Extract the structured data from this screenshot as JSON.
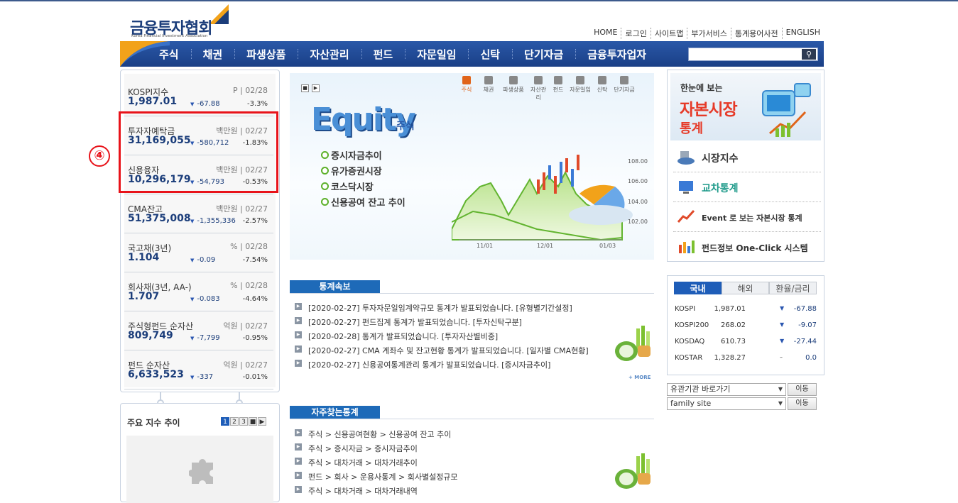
{
  "logo": {
    "name": "금융투자협회",
    "sub": "Korea Financial Investment Association"
  },
  "util_nav": [
    "HOME",
    "로그인",
    "사이트맵",
    "부가서비스",
    "통계용어사전",
    "ENGLISH"
  ],
  "gnb": [
    "주식",
    "채권",
    "파생상품",
    "자산관리",
    "펀드",
    "자문일임",
    "신탁",
    "단기자금",
    "금융투자업자"
  ],
  "indices": [
    {
      "name": "KOSPI지수",
      "meta": "P  |  02/28",
      "value": "1,987.01",
      "change": "-67.88",
      "pct": "-3.3%"
    },
    {
      "name": "투자자예탁금",
      "meta": "백만원  |  02/27",
      "value": "31,169,055",
      "change": "-580,712",
      "pct": "-1.83%"
    },
    {
      "name": "신용융자",
      "meta": "백만원  |  02/27",
      "value": "10,296,179",
      "change": "-54,793",
      "pct": "-0.53%"
    },
    {
      "name": "CMA잔고",
      "meta": "백만원  |  02/27",
      "value": "51,375,008",
      "change": "-1,355,336",
      "pct": "-2.57%"
    },
    {
      "name": "국고채(3년)",
      "meta": "%  |  02/28",
      "value": "1.104",
      "change": "-0.09",
      "pct": "-7.54%"
    },
    {
      "name": "회사채(3년, AA-)",
      "meta": "%  |  02/28",
      "value": "1.707",
      "change": "-0.083",
      "pct": "-4.64%"
    },
    {
      "name": "주식형펀드 순자산",
      "meta": "억원  |  02/27",
      "value": "809,749",
      "change": "-7,799",
      "pct": "-0.95%"
    },
    {
      "name": "펀드 순자산",
      "meta": "억원  |  02/27",
      "value": "6,633,523",
      "change": "-337",
      "pct": "-0.01%"
    }
  ],
  "annotation": "④",
  "main_index": {
    "title": "주요 지수 추이",
    "pages": [
      "1",
      "2",
      "3"
    ]
  },
  "banner": {
    "tabs": [
      "주식",
      "채권",
      "파생상품",
      "자산관리",
      "펀드",
      "자문일임",
      "신탁",
      "단기자금"
    ],
    "title": "Equity",
    "title_kr": "주식",
    "items": [
      "증시자금추이",
      "유가증권시장",
      "코스닥시장",
      "신용공여 잔고 추이"
    ],
    "chart_y": [
      "108.00",
      "106.00",
      "104.00",
      "102.00"
    ],
    "chart_x": [
      "11/01",
      "12/01",
      "01/03"
    ]
  },
  "stats": {
    "head1": "한눈에 보는",
    "head2": "자본시장",
    "head3": "통계",
    "items": [
      "시장지수",
      "교차통계",
      "Event 로 보는 자본시장 통계",
      "펀드정보 One-Click 시스템"
    ]
  },
  "market": {
    "tabs": [
      "국내",
      "해외",
      "환율/금리"
    ],
    "rows": [
      {
        "name": "KOSPI",
        "value": "1,987.01",
        "arrow": "▼",
        "change": "-67.88"
      },
      {
        "name": "KOSPI200",
        "value": "268.02",
        "arrow": "▼",
        "change": "-9.07"
      },
      {
        "name": "KOSDAQ",
        "value": "610.73",
        "arrow": "▼",
        "change": "-27.44"
      },
      {
        "name": "KOSTAR",
        "value": "1,328.27",
        "arrow": "–",
        "change": "0.0"
      }
    ]
  },
  "selects": {
    "org": "유관기관 바로가기",
    "family": "family site",
    "go": "이동"
  },
  "news": {
    "title": "통계속보",
    "items": [
      "[2020-02-27] 투자자문일임계약규모 통계가 발표되었습니다. [유형별기간설정]",
      "[2020-02-27] 펀드집계 통계가 발표되었습니다. [투자신탁구분]",
      "[2020-02-28] 통계가 발표되었습니다. [투자자산별비중]",
      "[2020-02-27] CMA 계좌수 및 잔고현황 통계가 발표되었습니다. [일자별 CMA현황]",
      "[2020-02-27] 신용공여통계관리 통계가 발표되었습니다. [증시자금추이]"
    ],
    "more": "+ MORE"
  },
  "freq": {
    "title": "자주찾는통계",
    "items": [
      "주식 > 신용공여현황 > 신용공여 잔고 추이",
      "주식 > 증시자금 > 증시자금추이",
      "주식 > 대차거래 > 대차거래추이",
      "펀드 > 회사 > 운용사통계 > 회사별설정규모",
      "주식 > 대차거래 > 대차거래내역"
    ]
  }
}
